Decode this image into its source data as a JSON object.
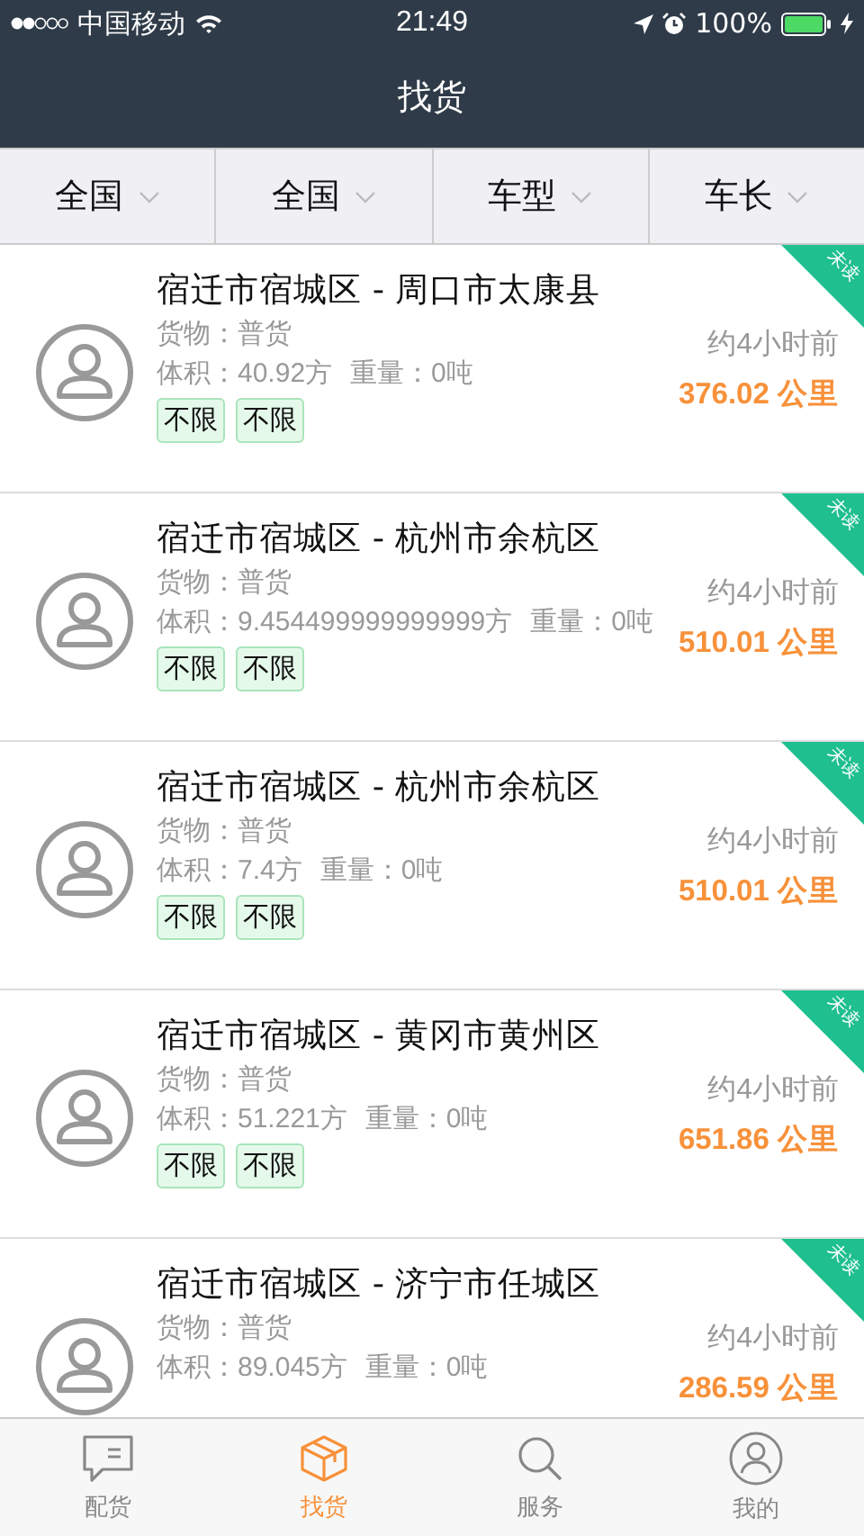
{
  "status_bar": {
    "carrier": "中国移动",
    "time": "21:49",
    "battery": "100%"
  },
  "nav": {
    "title": "找货"
  },
  "filters": [
    {
      "label": "全国"
    },
    {
      "label": "全国"
    },
    {
      "label": "车型"
    },
    {
      "label": "车长"
    }
  ],
  "listings": [
    {
      "route": "宿迁市宿城区 - 周口市太康县",
      "cargo": "货物：普货",
      "volume": "体积：40.92方",
      "weight": "重量：0吨",
      "tags": [
        "不限",
        "不限"
      ],
      "time": "约4小时前",
      "distance": "376.02 公里",
      "unread": true,
      "ribbon": "未读"
    },
    {
      "route": "宿迁市宿城区 - 杭州市余杭区",
      "cargo": "货物：普货",
      "volume": "体积：9.454499999999999方",
      "weight": "重量：0吨",
      "tags": [
        "不限",
        "不限"
      ],
      "time": "约4小时前",
      "distance": "510.01 公里",
      "unread": true,
      "ribbon": "未读"
    },
    {
      "route": "宿迁市宿城区 - 杭州市余杭区",
      "cargo": "货物：普货",
      "volume": "体积：7.4方",
      "weight": "重量：0吨",
      "tags": [
        "不限",
        "不限"
      ],
      "time": "约4小时前",
      "distance": "510.01 公里",
      "unread": true,
      "ribbon": "未读"
    },
    {
      "route": "宿迁市宿城区 - 黄冈市黄州区",
      "cargo": "货物：普货",
      "volume": "体积：51.221方",
      "weight": "重量：0吨",
      "tags": [
        "不限",
        "不限"
      ],
      "time": "约4小时前",
      "distance": "651.86 公里",
      "unread": true,
      "ribbon": "未读"
    },
    {
      "route": "宿迁市宿城区 - 济宁市任城区",
      "cargo": "货物：普货",
      "volume": "体积：89.045方",
      "weight": "重量：0吨",
      "time": "约4小时前",
      "distance": "286.59 公里",
      "unread": true,
      "ribbon": "未读"
    }
  ],
  "tab_bar": [
    {
      "label": "配货",
      "kind": "chat",
      "selected": false
    },
    {
      "label": "找货",
      "kind": "box",
      "selected": true
    },
    {
      "label": "服务",
      "kind": "search",
      "selected": false
    },
    {
      "label": "我的",
      "kind": "user",
      "selected": false
    }
  ]
}
